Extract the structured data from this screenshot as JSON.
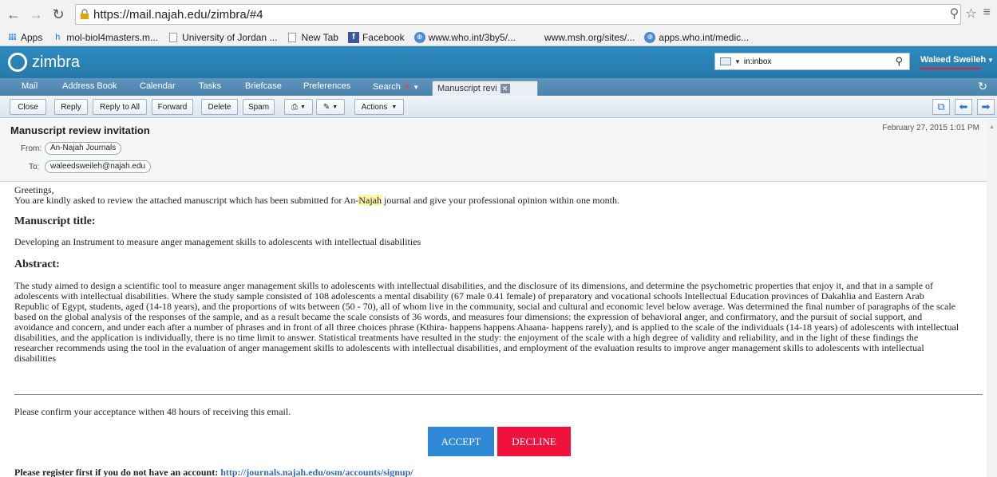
{
  "browser": {
    "url": "https://mail.najah.edu/zimbra/#4",
    "bookmarks": [
      {
        "label": "Apps",
        "icon": "apps-grid-icon"
      },
      {
        "label": "mol-biol4masters.m...",
        "icon": "site-h-icon"
      },
      {
        "label": "University of Jordan ...",
        "icon": "page-icon"
      },
      {
        "label": "New Tab",
        "icon": "page-icon"
      },
      {
        "label": "Facebook",
        "icon": "facebook-icon"
      },
      {
        "label": "www.who.int/3by5/...",
        "icon": "who-icon"
      },
      {
        "label": "www.msh.org/sites/...",
        "icon": "page-icon"
      },
      {
        "label": "apps.who.int/medic...",
        "icon": "who-icon"
      }
    ]
  },
  "zimbra": {
    "brand": "zimbra",
    "search_scope": "in:inbox",
    "user_name": "Waleed Sweileh",
    "app_tabs": [
      "Mail",
      "Address Book",
      "Calendar",
      "Tasks",
      "Briefcase",
      "Preferences",
      "Search"
    ],
    "doc_tab": "Manuscript revi"
  },
  "toolbar": {
    "close": "Close",
    "reply": "Reply",
    "reply_all": "Reply to All",
    "forward": "Forward",
    "delete": "Delete",
    "spam": "Spam",
    "actions": "Actions"
  },
  "message": {
    "subject": "Manuscript review invitation",
    "date": "February 27, 2015 1:01 PM",
    "from_label": "From:",
    "from": "An-Najah Journals",
    "to_label": "To:",
    "to": "waleedsweileh@najah.edu",
    "greeting": "Greetings,",
    "intro_before": "You are kindly asked to review the attached manuscript which has been submitted for An-",
    "intro_highlight": "Najah",
    "intro_after": " journal and give your professional opinion within one month.",
    "title_heading": "Manuscript title:",
    "title": "Developing an Instrument to measure anger management skills to adolescents with intellectual disabilities",
    "abstract_heading": "Abstract:",
    "abstract_lines": [
      "The study aimed to design a scientific tool to measure anger management skills to adolescents with intellectual disabilities, and the disclosure of its dimensions, and determine the psychometric properties that enjoy it, and that in a sample of",
      "adolescents with intellectual disabilities. Where the study sample consisted of 108 adolescents a mental disability (67 male 0.41 female) of preparatory and vocational schools Intellectual Education provinces of Dakahlia and Eastern Arab",
      "Republic of Egypt, students, aged (14-18 years), and the proportions of wits between (50 - 70), all of whom live in the community, social and cultural and economic level below average. Was determined the final number of paragraphs of the scale",
      "based on the global analysis of the responses of the sample, and as a result became the scale consists of 36 words, and measures four dimensions: the expression of behavioral anger, and confirmatory, and the pursuit of social support, and",
      "avoidance and concern, and under each after a number of phrases and in front of all three choices phrase (Kthira- happens happens Ahaana- happens rarely), and is applied to the scale of the individuals (14-18 years) of adolescents with intellectual",
      "disabilities, and the application is individually, there is no time limit to answer. Statistical treatments have resulted in the study: the enjoyment of the scale with a high degree of validity and reliability, and in the light of these findings the",
      "researcher recommends using the tool in the evaluation of anger management skills to adolescents with intellectual disabilities, and employment of the evaluation results to improve anger management skills to adolescents with intellectual",
      "disabilities"
    ],
    "confirm": "Please confirm your acceptance withen 48 hours of receiving this email.",
    "accept": "ACCEPT",
    "decline": "DECLINE",
    "register_text": "Please register first if you do not have an account: ",
    "register_link": "http://journals.najah.edu/osm/accounts/signup/"
  }
}
